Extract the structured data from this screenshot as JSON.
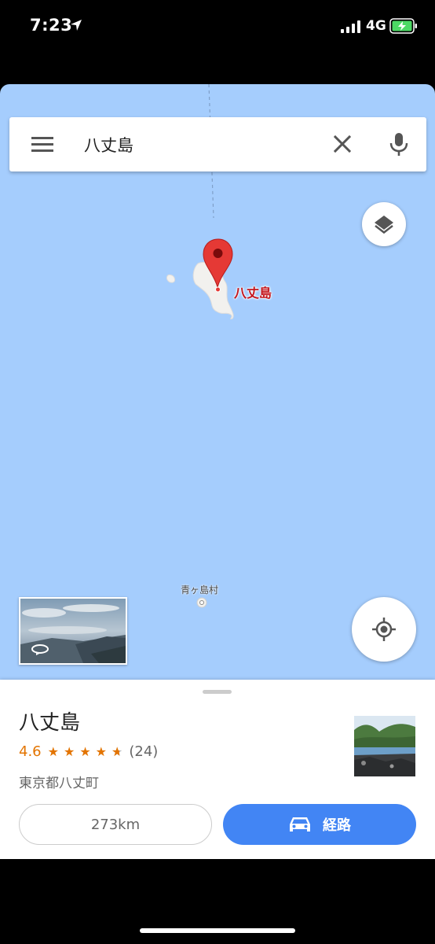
{
  "status_bar": {
    "time": "7:23",
    "network": "4G",
    "icons": [
      "location-arrow-icon",
      "signal-bars-icon",
      "battery-charging-icon"
    ],
    "battery_color": "#4cd964"
  },
  "search": {
    "query": "八丈島",
    "icons": [
      "menu-icon",
      "close-icon",
      "microphone-icon"
    ]
  },
  "map": {
    "water_color": "#a5cdfd",
    "land_color": "#f2f1ee",
    "pin_color": "#e53935",
    "labels": {
      "main_island": "八丈島",
      "aogashima": "青ヶ島村"
    }
  },
  "place": {
    "name": "八丈島",
    "rating": "4.6",
    "stars": 4.5,
    "reviews": "(24)",
    "address": "東京都八丈町"
  },
  "actions": {
    "distance": "273km",
    "directions": "経路",
    "accent_color": "#4285f4"
  }
}
